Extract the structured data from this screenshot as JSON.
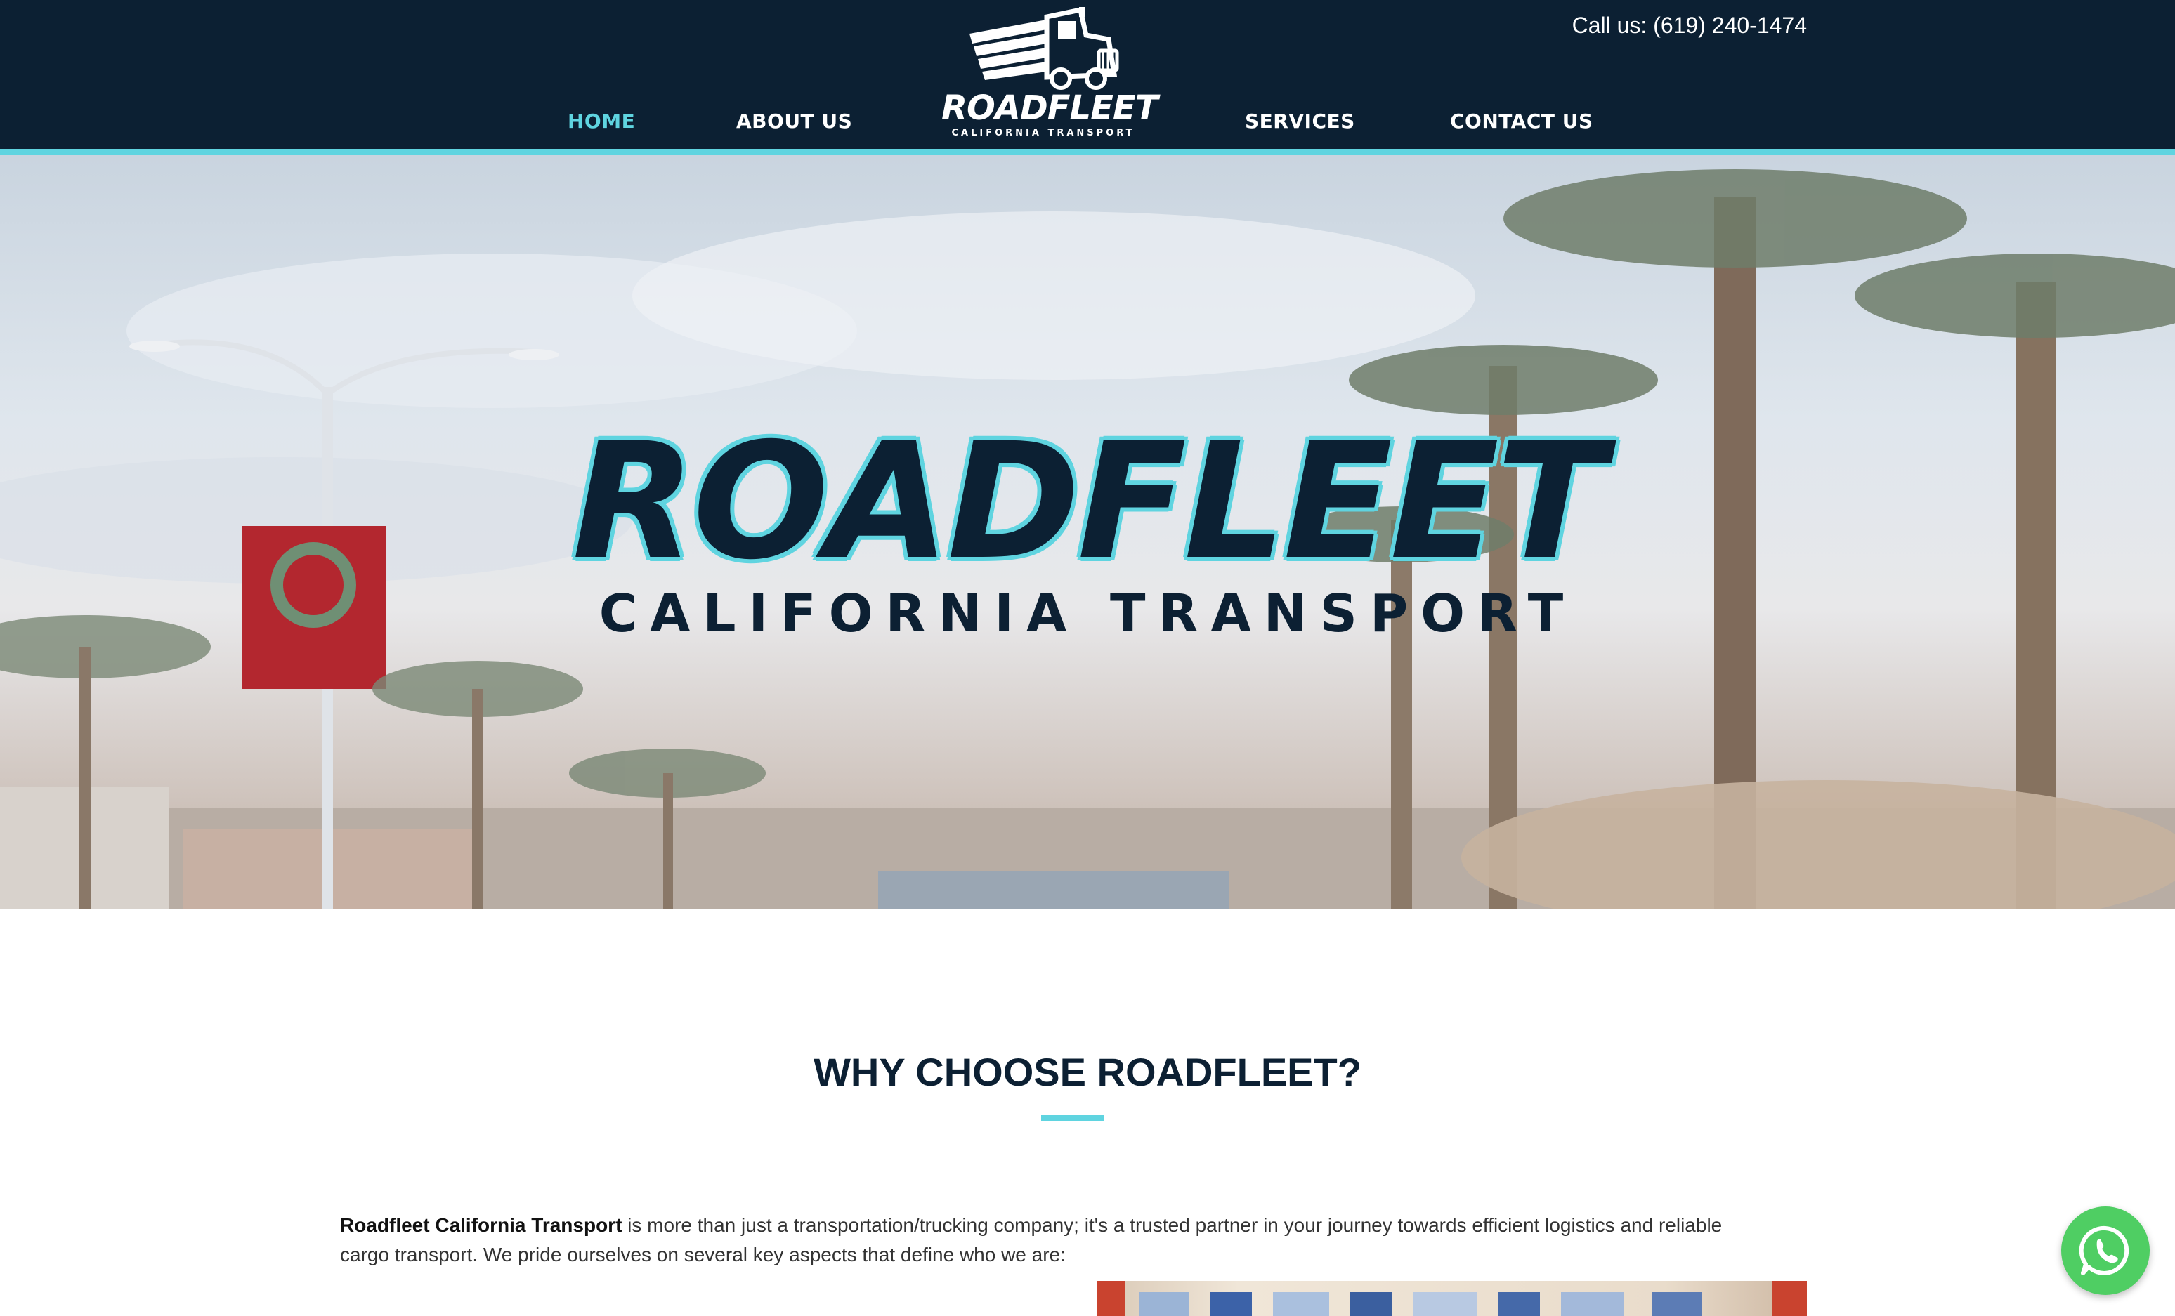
{
  "header": {
    "phone": "Call us: (619) 240-1474",
    "nav": [
      {
        "label": "HOME",
        "active": true
      },
      {
        "label": "ABOUT US",
        "active": false
      },
      {
        "label": "SERVICES",
        "active": false
      },
      {
        "label": "CONTACT US",
        "active": false
      }
    ],
    "logo": {
      "word": "ROADFLEET",
      "sub": "CALIFORNIA TRANSPORT"
    }
  },
  "hero": {
    "title": "ROADFLEET",
    "subtitle": "CALIFORNIA TRANSPORT"
  },
  "why": {
    "title": "WHY CHOOSE ROADFLEET?",
    "intro_bold": "Roadfleet California Transport",
    "intro_rest": " is more than just a transportation/trucking company; it's a trusted partner in your journey towards efficient logistics and reliable cargo transport. We pride ourselves on several key aspects that define who we are:"
  },
  "colors": {
    "navy": "#0c2033",
    "accent": "#5fd4e0",
    "whatsapp": "#4fce63"
  },
  "icons": {
    "logo": "truck-icon",
    "chat": "whatsapp-icon"
  }
}
